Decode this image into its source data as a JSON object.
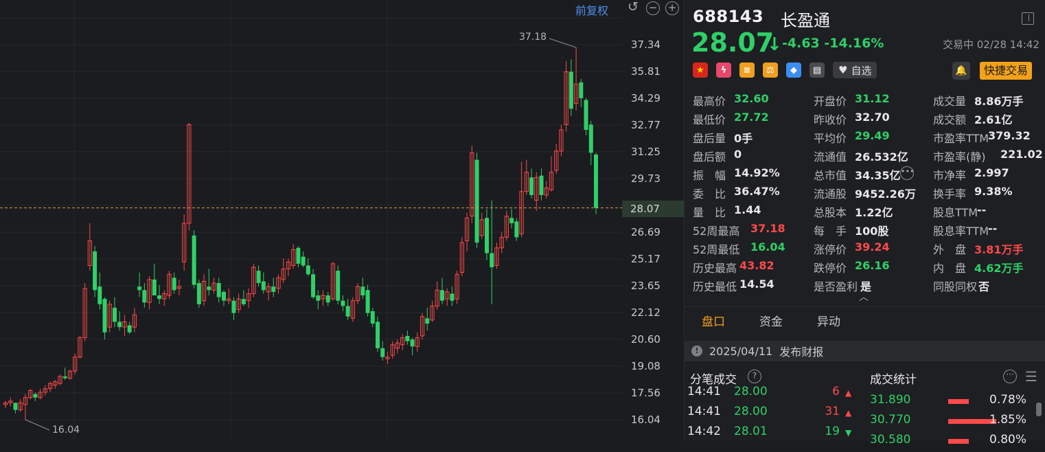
{
  "chart": {
    "adjust_label": "前复权",
    "y_ticks": [
      "37.34",
      "35.81",
      "34.29",
      "32.77",
      "31.25",
      "29.73",
      "28.07",
      "26.69",
      "25.17",
      "23.65",
      "22.12",
      "20.60",
      "19.08",
      "17.56",
      "16.04"
    ],
    "current_price_tag": "28.07",
    "max_label": "37.18",
    "min_label": "16.04",
    "up_color": "#ff4a4a",
    "down_color": "#2fd068"
  },
  "chart_data": {
    "type": "candlestick",
    "ylim": [
      16.04,
      37.34
    ],
    "last_price": 28.07,
    "high": 37.18,
    "low": 16.04,
    "candles": [
      [
        16.9,
        17.1,
        16.7,
        17.0
      ],
      [
        17.0,
        17.3,
        16.8,
        17.1
      ],
      [
        17.0,
        17.0,
        16.4,
        16.6
      ],
      [
        16.6,
        17.2,
        16.5,
        17.0
      ],
      [
        16.9,
        17.5,
        16.04,
        17.3
      ],
      [
        17.3,
        17.8,
        17.2,
        17.7
      ],
      [
        17.5,
        17.6,
        17.1,
        17.3
      ],
      [
        17.3,
        17.8,
        17.2,
        17.6
      ],
      [
        17.6,
        18.0,
        17.4,
        17.8
      ],
      [
        17.8,
        18.2,
        17.6,
        18.1
      ],
      [
        18.0,
        18.3,
        17.8,
        18.2
      ],
      [
        18.1,
        18.6,
        18.0,
        18.5
      ],
      [
        18.5,
        19.0,
        18.3,
        18.4
      ],
      [
        18.4,
        18.9,
        18.3,
        18.8
      ],
      [
        18.8,
        19.8,
        18.6,
        19.6
      ],
      [
        19.6,
        20.8,
        19.5,
        20.7
      ],
      [
        20.7,
        23.8,
        20.5,
        23.5
      ],
      [
        24.8,
        27.2,
        24.5,
        26.2
      ],
      [
        25.6,
        25.9,
        23.0,
        23.4
      ],
      [
        23.6,
        24.4,
        22.3,
        22.6
      ],
      [
        22.9,
        23.0,
        20.6,
        21.0
      ],
      [
        21.3,
        22.8,
        21.0,
        22.6
      ],
      [
        22.4,
        23.0,
        21.3,
        21.6
      ],
      [
        21.6,
        22.2,
        21.1,
        21.3
      ],
      [
        21.3,
        22.0,
        20.8,
        21.6
      ],
      [
        21.4,
        21.6,
        20.9,
        21.0
      ],
      [
        21.3,
        22.4,
        21.0,
        22.0
      ],
      [
        23.6,
        24.4,
        23.0,
        23.4
      ],
      [
        23.4,
        23.8,
        22.4,
        22.7
      ],
      [
        22.7,
        24.2,
        22.3,
        24.0
      ],
      [
        24.0,
        24.9,
        23.4,
        23.1
      ],
      [
        23.1,
        23.7,
        22.6,
        22.9
      ],
      [
        22.9,
        23.4,
        22.5,
        23.2
      ],
      [
        23.1,
        24.5,
        22.9,
        24.3
      ],
      [
        24.1,
        24.4,
        23.2,
        23.4
      ],
      [
        23.5,
        24.0,
        23.1,
        23.6
      ],
      [
        25.0,
        27.7,
        24.5,
        27.2
      ],
      [
        27.2,
        32.9,
        26.8,
        32.8
      ],
      [
        26.5,
        26.8,
        23.5,
        23.7
      ],
      [
        23.8,
        24.0,
        22.4,
        22.6
      ],
      [
        22.8,
        24.3,
        22.5,
        23.9
      ],
      [
        23.6,
        24.6,
        23.1,
        23.4
      ],
      [
        23.4,
        24.1,
        23.2,
        23.8
      ],
      [
        23.8,
        24.1,
        22.7,
        23.0
      ],
      [
        23.3,
        23.4,
        22.5,
        22.8
      ],
      [
        22.8,
        23.5,
        22.6,
        22.9
      ],
      [
        22.8,
        23.0,
        21.7,
        22.1
      ],
      [
        22.3,
        23.2,
        22.1,
        22.9
      ],
      [
        22.9,
        23.4,
        22.5,
        22.6
      ],
      [
        22.8,
        23.5,
        22.4,
        23.2
      ],
      [
        23.2,
        24.9,
        23.0,
        24.7
      ],
      [
        24.5,
        24.8,
        23.6,
        23.8
      ],
      [
        23.9,
        24.4,
        23.2,
        23.4
      ],
      [
        23.3,
        23.8,
        22.8,
        23.6
      ],
      [
        23.6,
        24.1,
        23.0,
        23.3
      ],
      [
        23.5,
        24.3,
        23.2,
        24.1
      ],
      [
        24.0,
        25.2,
        23.8,
        24.6
      ],
      [
        24.6,
        25.2,
        24.2,
        25.0
      ],
      [
        24.8,
        26.0,
        24.6,
        25.7
      ],
      [
        25.8,
        25.9,
        24.7,
        24.9
      ],
      [
        25.3,
        25.6,
        24.7,
        24.8
      ],
      [
        24.8,
        25.2,
        24.2,
        24.3
      ],
      [
        24.3,
        24.6,
        22.9,
        23.0
      ],
      [
        23.1,
        23.4,
        22.3,
        22.8
      ],
      [
        22.9,
        23.4,
        22.5,
        23.1
      ],
      [
        23.1,
        23.3,
        22.5,
        22.7
      ],
      [
        22.9,
        25.0,
        22.8,
        24.9
      ],
      [
        24.5,
        24.8,
        22.6,
        22.8
      ],
      [
        22.8,
        23.1,
        22.2,
        22.5
      ],
      [
        22.5,
        22.9,
        21.7,
        21.9
      ],
      [
        21.8,
        23.0,
        21.6,
        22.8
      ],
      [
        22.8,
        23.8,
        22.6,
        23.6
      ],
      [
        23.6,
        24.1,
        22.9,
        23.1
      ],
      [
        23.4,
        23.7,
        21.9,
        22.1
      ],
      [
        22.2,
        22.4,
        21.3,
        21.5
      ],
      [
        21.6,
        21.9,
        19.9,
        20.1
      ],
      [
        20.1,
        20.5,
        19.4,
        19.6
      ],
      [
        19.5,
        19.9,
        19.2,
        19.6
      ],
      [
        19.7,
        20.5,
        19.5,
        20.3
      ],
      [
        20.1,
        20.6,
        19.8,
        20.4
      ],
      [
        20.3,
        20.9,
        20.0,
        20.7
      ],
      [
        20.8,
        21.1,
        20.3,
        20.5
      ],
      [
        20.6,
        20.7,
        19.7,
        20.2
      ],
      [
        20.2,
        21.0,
        19.9,
        20.7
      ],
      [
        20.8,
        22.1,
        20.6,
        21.9
      ],
      [
        21.8,
        22.4,
        21.1,
        21.5
      ],
      [
        21.7,
        22.8,
        21.6,
        22.5
      ],
      [
        22.5,
        23.9,
        22.3,
        23.4
      ],
      [
        23.4,
        24.1,
        22.6,
        22.8
      ],
      [
        22.9,
        23.5,
        22.5,
        23.3
      ],
      [
        23.2,
        23.6,
        22.5,
        22.8
      ],
      [
        22.9,
        24.5,
        22.6,
        24.3
      ],
      [
        24.4,
        26.4,
        24.2,
        26.1
      ],
      [
        26.2,
        27.8,
        25.6,
        27.5
      ],
      [
        27.6,
        31.6,
        27.2,
        31.2
      ],
      [
        30.8,
        31.2,
        25.8,
        26.1
      ],
      [
        26.5,
        27.8,
        26.3,
        27.4
      ],
      [
        27.5,
        28.0,
        25.1,
        25.5
      ],
      [
        25.5,
        28.5,
        22.6,
        24.7
      ],
      [
        24.8,
        26.1,
        24.6,
        25.8
      ],
      [
        25.8,
        26.7,
        25.5,
        26.4
      ],
      [
        26.4,
        27.9,
        26.2,
        27.6
      ],
      [
        27.5,
        28.0,
        26.9,
        27.2
      ],
      [
        27.3,
        27.5,
        26.2,
        26.4
      ],
      [
        26.6,
        30.7,
        26.4,
        29.0
      ],
      [
        29.0,
        30.8,
        28.8,
        30.1
      ],
      [
        29.8,
        30.3,
        28.6,
        28.8
      ],
      [
        28.5,
        30.1,
        27.9,
        29.8
      ],
      [
        29.9,
        30.3,
        28.5,
        28.8
      ],
      [
        28.8,
        29.6,
        28.6,
        29.2
      ],
      [
        29.1,
        31.0,
        29.0,
        30.1
      ],
      [
        30.2,
        31.7,
        30.0,
        31.3
      ],
      [
        31.3,
        32.8,
        31.0,
        32.5
      ],
      [
        32.8,
        36.4,
        32.4,
        35.8
      ],
      [
        35.8,
        36.5,
        33.3,
        33.7
      ],
      [
        34.0,
        37.18,
        33.6,
        35.1
      ],
      [
        35.2,
        35.4,
        33.8,
        34.3
      ],
      [
        34.2,
        34.3,
        32.2,
        32.5
      ],
      [
        32.8,
        33.0,
        30.5,
        31.2
      ],
      [
        31.1,
        31.2,
        27.72,
        28.07
      ]
    ]
  },
  "header": {
    "code": "688143",
    "name": "长盈通",
    "price": "28.07",
    "change": "-4.63",
    "change_pct": "-14.16%",
    "status": "交易中 02/28 14:42",
    "watch_label": "自选",
    "quick_trade": "快捷交易"
  },
  "quotes": [
    [
      {
        "label": "最高价",
        "value": "32.60",
        "color": "green"
      },
      {
        "label": "开盘价",
        "value": "31.12",
        "color": "green"
      },
      {
        "label": "成交量",
        "value": "8.86万手",
        "color": "white"
      }
    ],
    [
      {
        "label": "最低价",
        "value": "27.72",
        "color": "green"
      },
      {
        "label": "昨收价",
        "value": "32.70",
        "color": "white"
      },
      {
        "label": "成交额",
        "value": "2.61亿",
        "color": "white"
      }
    ],
    [
      {
        "label": "盘后量",
        "value": "0手",
        "color": "white"
      },
      {
        "label": "平均价",
        "value": "29.49",
        "color": "green"
      },
      {
        "label": "市盈率TTM",
        "value": "379.32",
        "color": "white"
      }
    ],
    [
      {
        "label": "盘后额",
        "value": "0",
        "color": "white"
      },
      {
        "label": "流通值",
        "value": "26.532亿",
        "color": "white"
      },
      {
        "label": "市盈率(静)",
        "value": "221.02",
        "color": "white"
      }
    ],
    [
      {
        "label": "振　幅",
        "value": "14.92%",
        "color": "white"
      },
      {
        "label": "总市值",
        "value": "34.35亿",
        "color": "white"
      },
      {
        "label": "市净率",
        "value": "2.997",
        "color": "white"
      }
    ],
    [
      {
        "label": "委　比",
        "value": "36.47%",
        "color": "white"
      },
      {
        "label": "流通股",
        "value": "9452.26万",
        "color": "white"
      },
      {
        "label": "换手率",
        "value": "9.38%",
        "color": "white"
      }
    ],
    [
      {
        "label": "量　比",
        "value": "1.44",
        "color": "white"
      },
      {
        "label": "总股本",
        "value": "1.22亿",
        "color": "white"
      },
      {
        "label": "股息TTM",
        "value": "--",
        "color": "white"
      }
    ],
    [
      {
        "label": "52周最高",
        "value": "37.18",
        "color": "red"
      },
      {
        "label": "每　手",
        "value": "100股",
        "color": "white"
      },
      {
        "label": "股息率TTM",
        "value": "--",
        "color": "white"
      }
    ],
    [
      {
        "label": "52周最低",
        "value": "16.04",
        "color": "green"
      },
      {
        "label": "涨停价",
        "value": "39.24",
        "color": "red"
      },
      {
        "label": "外　盘",
        "value": "3.81万手",
        "color": "red"
      }
    ],
    [
      {
        "label": "历史最高",
        "value": "43.82",
        "color": "red"
      },
      {
        "label": "跌停价",
        "value": "26.16",
        "color": "green"
      },
      {
        "label": "内　盘",
        "value": "4.62万手",
        "color": "green"
      }
    ],
    [
      {
        "label": "历史最低",
        "value": "14.54",
        "color": "white"
      },
      {
        "label": "是否盈利",
        "value": "是",
        "color": "white"
      },
      {
        "label": "同股同权",
        "value": "否",
        "color": "white"
      }
    ]
  ],
  "tabs": [
    "盘口",
    "资金",
    "异动"
  ],
  "notice": {
    "date": "2025/04/11",
    "text": "发布财报"
  },
  "ticks_title": "分笔成交",
  "stats_title": "成交统计",
  "ticks": [
    {
      "time": "14:41",
      "price": "28.00",
      "vol": "6",
      "dir": "up"
    },
    {
      "time": "14:41",
      "price": "28.00",
      "vol": "31",
      "dir": "up"
    },
    {
      "time": "14:42",
      "price": "28.01",
      "vol": "19",
      "dir": "down"
    }
  ],
  "stats": [
    {
      "price": "31.890",
      "pct": "0.78%",
      "fill": 0.78
    },
    {
      "price": "30.770",
      "pct": "1.85%",
      "fill": 1.85
    },
    {
      "price": "30.580",
      "pct": "0.80%",
      "fill": 0.8
    }
  ]
}
